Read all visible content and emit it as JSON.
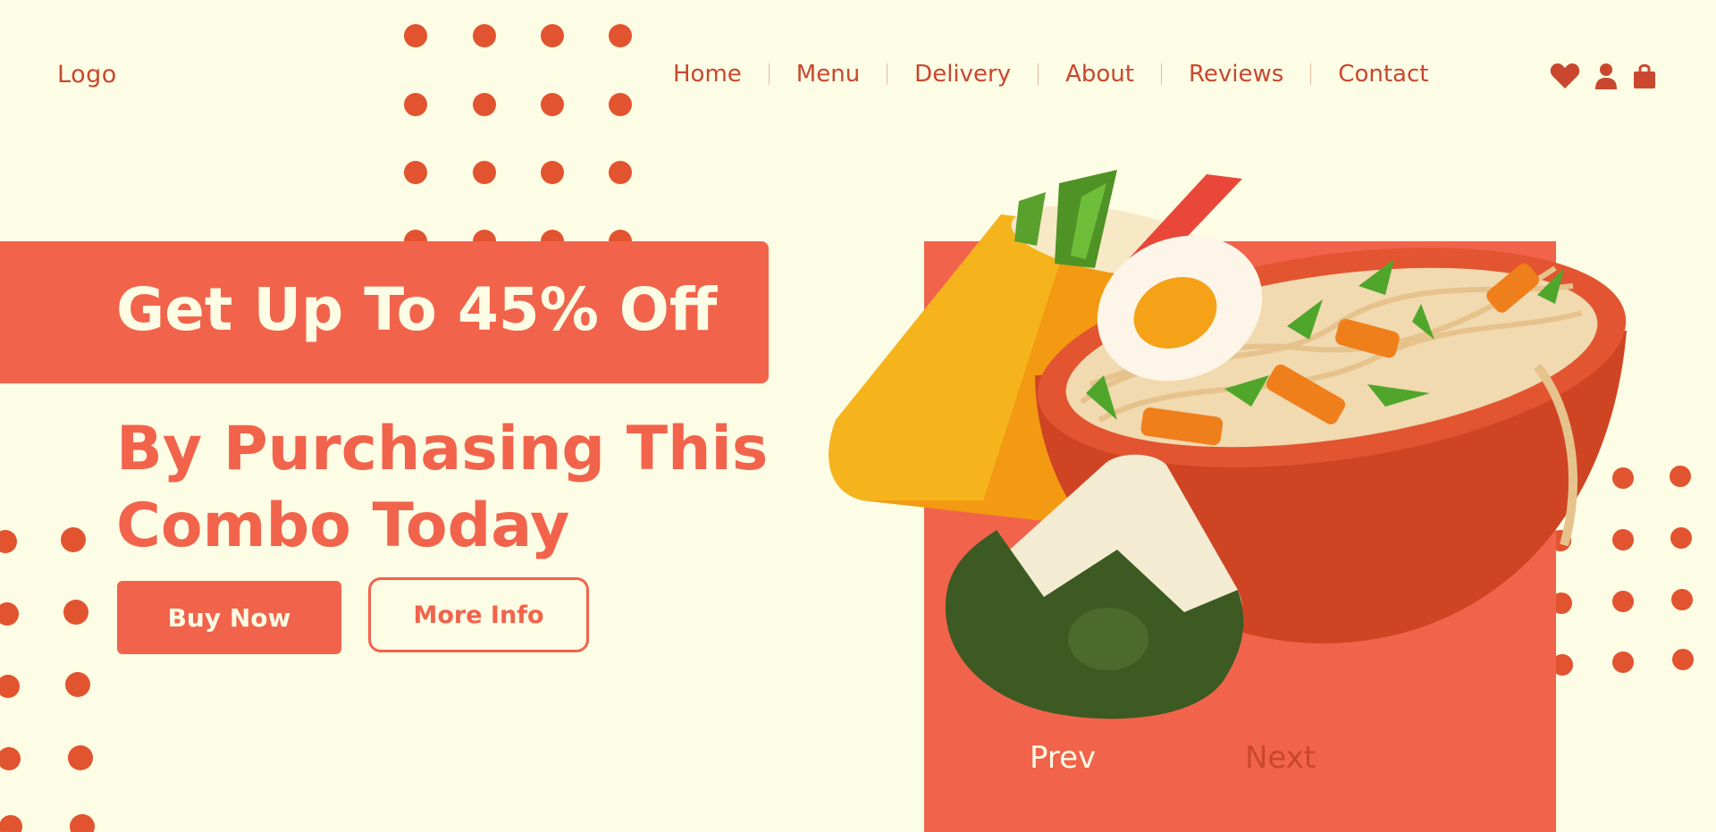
{
  "header": {
    "logo": "Logo",
    "nav": [
      "Home",
      "Menu",
      "Delivery",
      "About",
      "Reviews",
      "Contact"
    ],
    "icons": [
      "heart-icon",
      "user-icon",
      "shopping-bag-icon"
    ]
  },
  "hero": {
    "banner": "Get Up To 45% Off",
    "line1": "By Purchasing This",
    "line2": "Combo Today",
    "buy_label": "Buy Now",
    "more_label": "More Info"
  },
  "slider": {
    "prev_label": "Prev",
    "next_label": "Next"
  },
  "colors": {
    "background": "#fdfce4",
    "accent": "#f2634c",
    "text": "#c9472f",
    "dots": "#e2532f"
  }
}
